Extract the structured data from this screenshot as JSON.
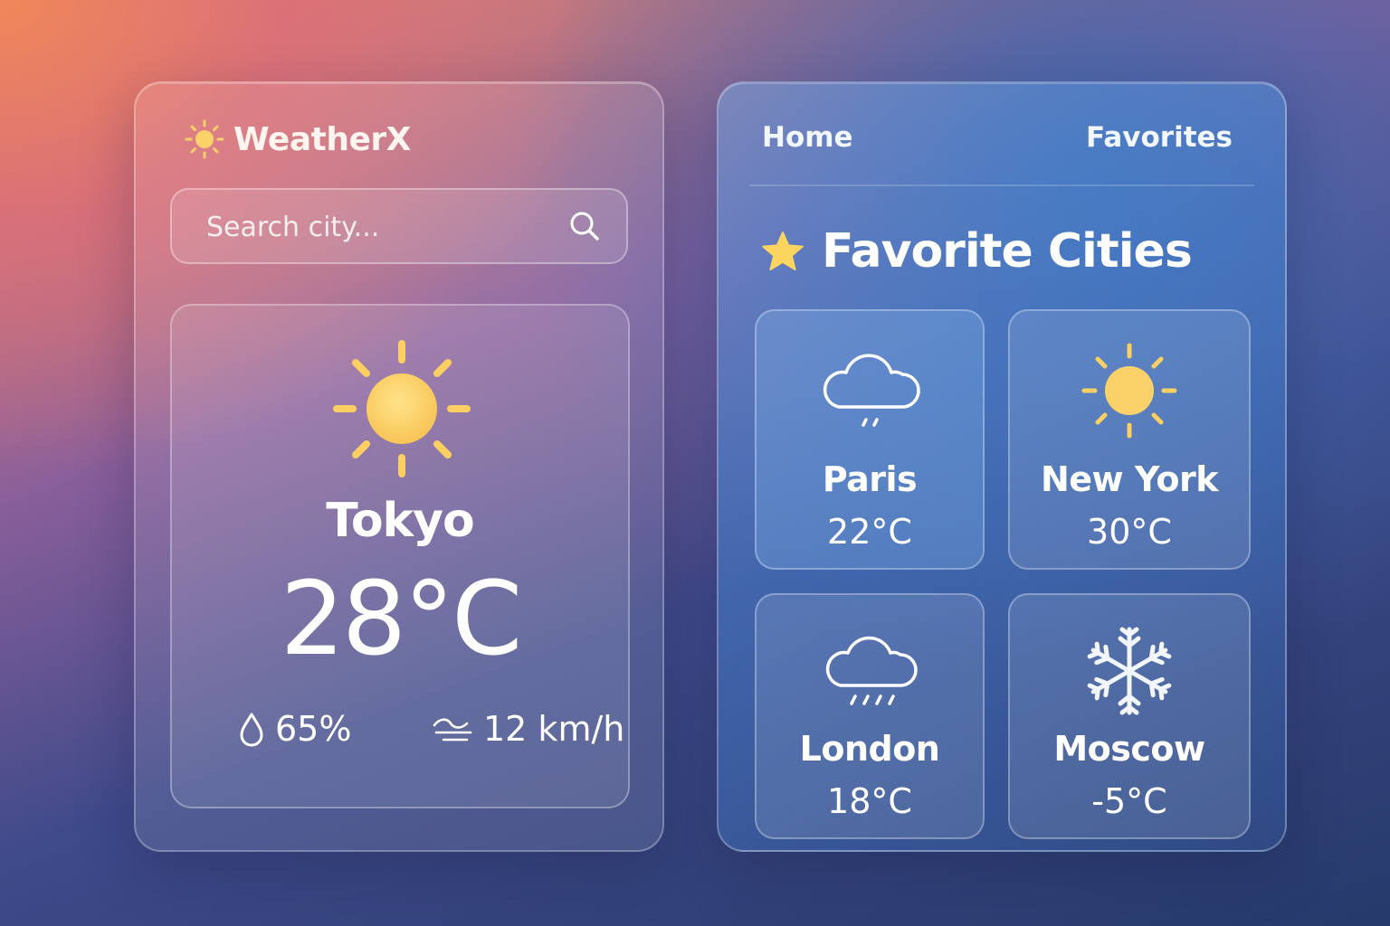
{
  "app": {
    "name": "WeatherX",
    "icon": "sun-icon"
  },
  "search": {
    "placeholder": "Search city...",
    "icon": "search-icon"
  },
  "current": {
    "city": "Tokyo",
    "temperature": "28°C",
    "condition_icon": "sun-icon",
    "humidity": "65%",
    "humidity_icon": "droplet-icon",
    "wind": "12 km/h",
    "wind_icon": "wind-icon"
  },
  "nav": {
    "home": "Home",
    "favorites": "Favorites"
  },
  "favorites": {
    "title": "Favorite Cities",
    "title_icon": "star-icon",
    "cities": [
      {
        "name": "Paris",
        "temp": "22°C",
        "icon": "light-rain-cloud-icon"
      },
      {
        "name": "New York",
        "temp": "30°C",
        "icon": "sun-icon"
      },
      {
        "name": "London",
        "temp": "18°C",
        "icon": "rain-cloud-icon"
      },
      {
        "name": "Moscow",
        "temp": "-5°C",
        "icon": "snowflake-icon"
      }
    ]
  },
  "colors": {
    "sun": "#fbd16a",
    "star": "#fcd560",
    "text": "#ffffff"
  }
}
